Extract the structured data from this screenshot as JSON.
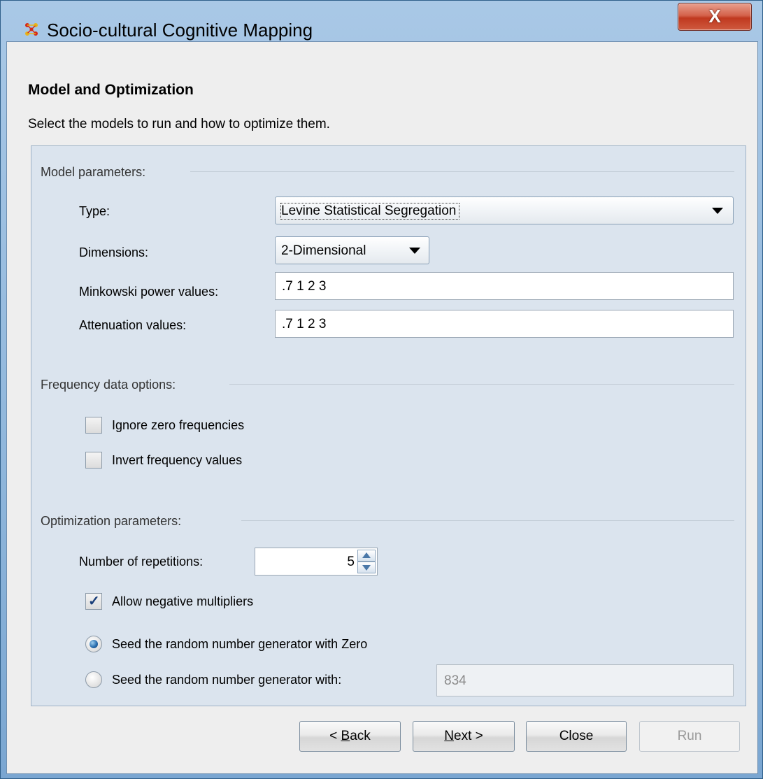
{
  "window": {
    "title": "Socio-cultural Cognitive Mapping",
    "close_label": "X"
  },
  "page": {
    "title": "Model and Optimization",
    "description": "Select the models to run and how to optimize them."
  },
  "model_parameters": {
    "group_label": "Model parameters:",
    "type_label": "Type:",
    "type_value": "Levine Statistical Segregation",
    "dimensions_label": "Dimensions:",
    "dimensions_value": "2-Dimensional",
    "minkowski_label": "Minkowski power values:",
    "minkowski_value": ".7 1 2 3",
    "attenuation_label": "Attenuation values:",
    "attenuation_value": ".7 1 2 3"
  },
  "frequency_options": {
    "group_label": "Frequency data options:",
    "ignore_zero_label": "Ignore zero frequencies",
    "ignore_zero_checked": false,
    "invert_label": "Invert frequency values",
    "invert_checked": false
  },
  "optimization": {
    "group_label": "Optimization parameters:",
    "repetitions_label": "Number of repetitions:",
    "repetitions_value": "5",
    "allow_negative_label": "Allow negative multipliers",
    "allow_negative_checked": true,
    "seed_zero_label": "Seed the random number generator with Zero",
    "seed_zero_selected": true,
    "seed_custom_label": "Seed the random number generator with:",
    "seed_custom_value": "834"
  },
  "buttons": {
    "back_prefix": "< ",
    "back_mnemonic": "B",
    "back_rest": "ack",
    "next_mnemonic": "N",
    "next_rest": "ext >",
    "close": "Close",
    "run": "Run"
  }
}
